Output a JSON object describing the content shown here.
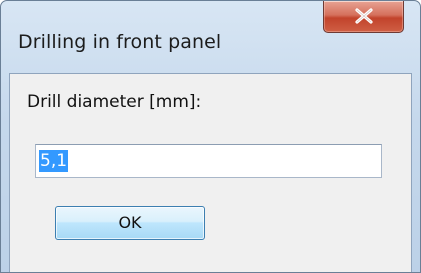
{
  "window": {
    "title": "Drilling in front panel"
  },
  "controls": {
    "close_icon": "close-icon",
    "close_color": "#c7432b"
  },
  "form": {
    "label": "Drill diameter [mm]:",
    "value": "5,1",
    "value_selected": true,
    "selection_color": "#3399ff"
  },
  "buttons": {
    "ok_label": "OK"
  }
}
